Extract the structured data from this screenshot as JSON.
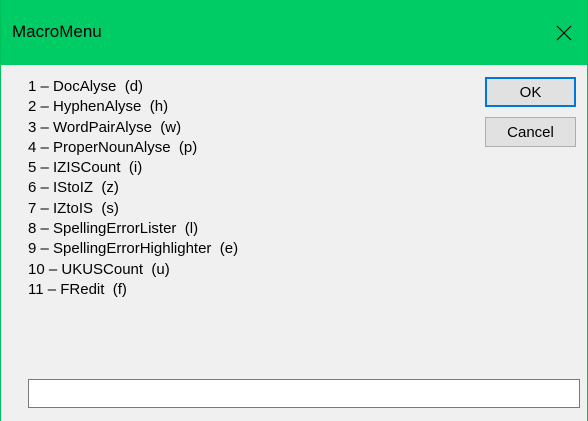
{
  "window": {
    "title": "MacroMenu",
    "title_bar_color": "#00cc66",
    "close_icon": "close-icon"
  },
  "macros": [
    {
      "label": "1 – DocAlyse  (d)"
    },
    {
      "label": "2 – HyphenAlyse  (h)"
    },
    {
      "label": "3 – WordPairAlyse  (w)"
    },
    {
      "label": "4 – ProperNounAlyse  (p)"
    },
    {
      "label": "5 – IZISCount  (i)"
    },
    {
      "label": "6 – IStoIZ  (z)"
    },
    {
      "label": "7 – IZtoIS  (s)"
    },
    {
      "label": "8 – SpellingErrorLister  (l)"
    },
    {
      "label": "9 – SpellingErrorHighlighter  (e)"
    },
    {
      "label": "10 – UKUSCount  (u)"
    },
    {
      "label": "11 – FRedit  (f)"
    }
  ],
  "buttons": {
    "ok_label": "OK",
    "cancel_label": "Cancel"
  },
  "input": {
    "value": "",
    "placeholder": ""
  }
}
